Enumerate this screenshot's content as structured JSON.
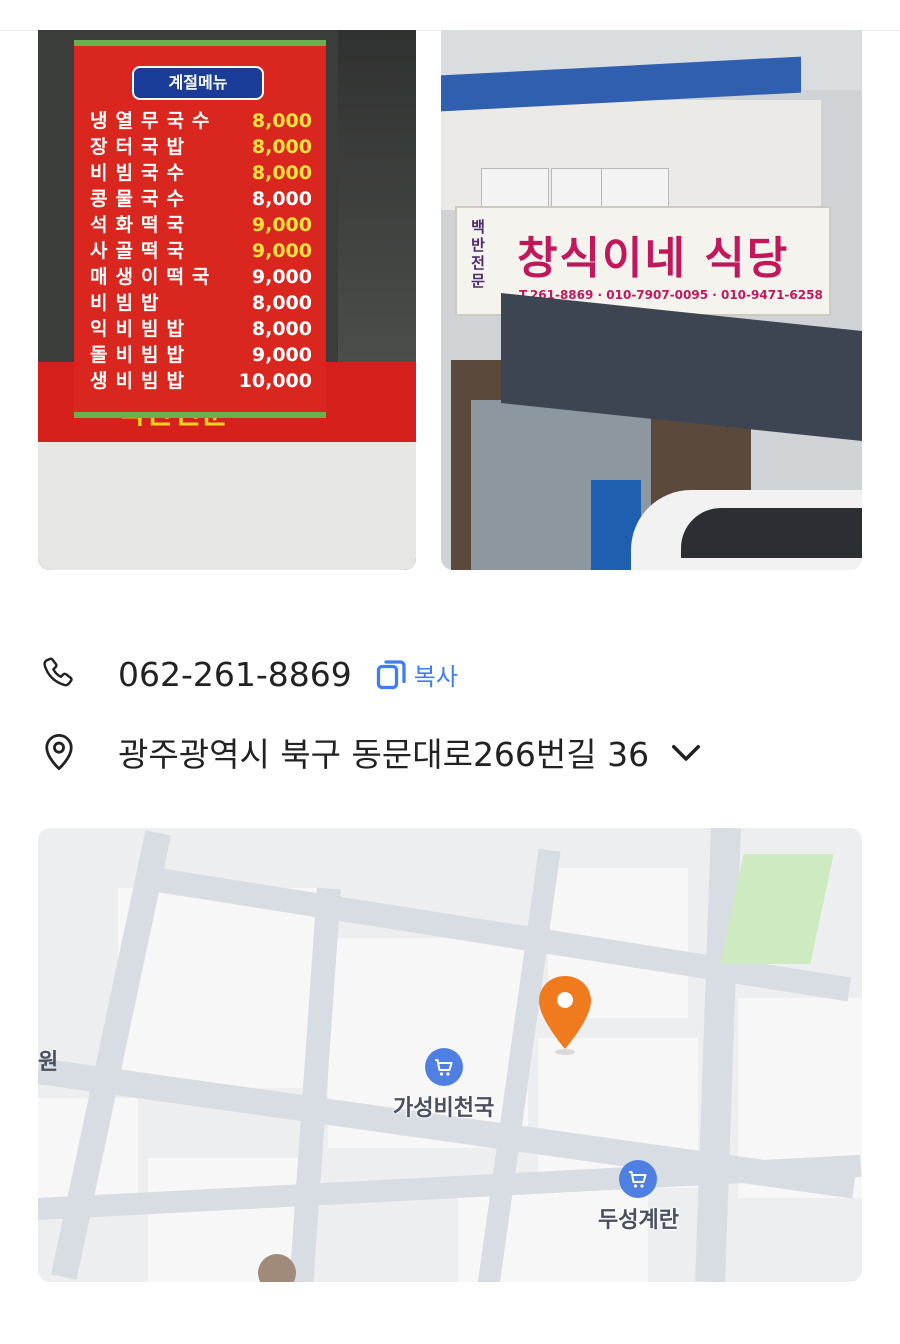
{
  "menu_board": {
    "title": "계절메뉴",
    "items": [
      {
        "name": "냉열무국수",
        "price": "8,000"
      },
      {
        "name": "장터국밥",
        "price": "8,000"
      },
      {
        "name": "비빔국수",
        "price": "8,000"
      },
      {
        "name": "콩물국수",
        "price": "8,000"
      },
      {
        "name": "석화떡국",
        "price": "9,000"
      },
      {
        "name": "사골떡국",
        "price": "9,000"
      },
      {
        "name": "매생이떡국",
        "price": "9,000"
      },
      {
        "name": "비빔밥",
        "price": "8,000"
      },
      {
        "name": "익비빔밥",
        "price": "8,000"
      },
      {
        "name": "돌비빔밥",
        "price": "9,000"
      },
      {
        "name": "생비빔밥",
        "price": "10,000"
      }
    ],
    "band_text": "국산전문"
  },
  "storefront": {
    "sign_sub": "백반전문",
    "sign_name": "창식이네 식당",
    "sign_phones": "T.261-8869 · 010-7907-0095 · 010-9471-6258"
  },
  "contact": {
    "phone": "062-261-8869",
    "copy_label": "복사",
    "address": "광주광역시 북구 동문대로266번길 36"
  },
  "map": {
    "pois": [
      {
        "label": "가성비천국",
        "icon": "cart-icon"
      },
      {
        "label": "두성계란",
        "icon": "cart-icon"
      }
    ],
    "edge_label": "원",
    "marker_color": "#f07b1f",
    "poi_color": "#4f7fe0"
  },
  "colors": {
    "accent": "#3d7ef0",
    "text": "#222222"
  }
}
